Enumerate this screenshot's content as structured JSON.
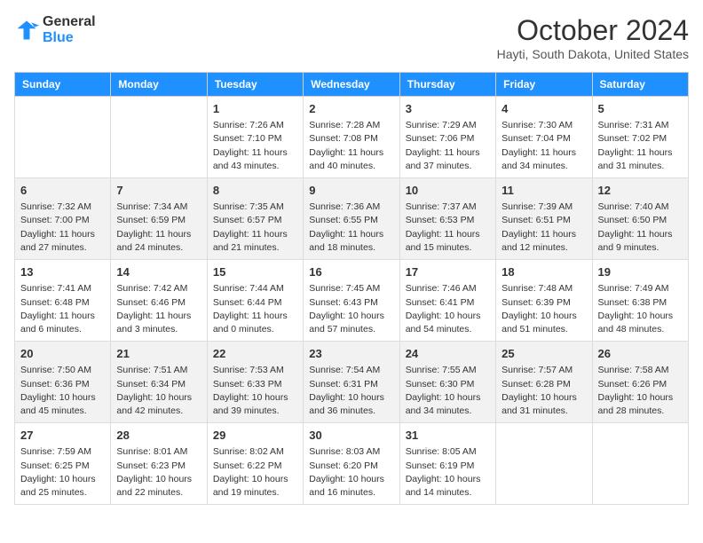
{
  "header": {
    "logo_line1": "General",
    "logo_line2": "Blue",
    "month": "October 2024",
    "location": "Hayti, South Dakota, United States"
  },
  "days_of_week": [
    "Sunday",
    "Monday",
    "Tuesday",
    "Wednesday",
    "Thursday",
    "Friday",
    "Saturday"
  ],
  "weeks": [
    [
      {
        "day": "",
        "info": ""
      },
      {
        "day": "",
        "info": ""
      },
      {
        "day": "1",
        "info": "Sunrise: 7:26 AM\nSunset: 7:10 PM\nDaylight: 11 hours and 43 minutes."
      },
      {
        "day": "2",
        "info": "Sunrise: 7:28 AM\nSunset: 7:08 PM\nDaylight: 11 hours and 40 minutes."
      },
      {
        "day": "3",
        "info": "Sunrise: 7:29 AM\nSunset: 7:06 PM\nDaylight: 11 hours and 37 minutes."
      },
      {
        "day": "4",
        "info": "Sunrise: 7:30 AM\nSunset: 7:04 PM\nDaylight: 11 hours and 34 minutes."
      },
      {
        "day": "5",
        "info": "Sunrise: 7:31 AM\nSunset: 7:02 PM\nDaylight: 11 hours and 31 minutes."
      }
    ],
    [
      {
        "day": "6",
        "info": "Sunrise: 7:32 AM\nSunset: 7:00 PM\nDaylight: 11 hours and 27 minutes."
      },
      {
        "day": "7",
        "info": "Sunrise: 7:34 AM\nSunset: 6:59 PM\nDaylight: 11 hours and 24 minutes."
      },
      {
        "day": "8",
        "info": "Sunrise: 7:35 AM\nSunset: 6:57 PM\nDaylight: 11 hours and 21 minutes."
      },
      {
        "day": "9",
        "info": "Sunrise: 7:36 AM\nSunset: 6:55 PM\nDaylight: 11 hours and 18 minutes."
      },
      {
        "day": "10",
        "info": "Sunrise: 7:37 AM\nSunset: 6:53 PM\nDaylight: 11 hours and 15 minutes."
      },
      {
        "day": "11",
        "info": "Sunrise: 7:39 AM\nSunset: 6:51 PM\nDaylight: 11 hours and 12 minutes."
      },
      {
        "day": "12",
        "info": "Sunrise: 7:40 AM\nSunset: 6:50 PM\nDaylight: 11 hours and 9 minutes."
      }
    ],
    [
      {
        "day": "13",
        "info": "Sunrise: 7:41 AM\nSunset: 6:48 PM\nDaylight: 11 hours and 6 minutes."
      },
      {
        "day": "14",
        "info": "Sunrise: 7:42 AM\nSunset: 6:46 PM\nDaylight: 11 hours and 3 minutes."
      },
      {
        "day": "15",
        "info": "Sunrise: 7:44 AM\nSunset: 6:44 PM\nDaylight: 11 hours and 0 minutes."
      },
      {
        "day": "16",
        "info": "Sunrise: 7:45 AM\nSunset: 6:43 PM\nDaylight: 10 hours and 57 minutes."
      },
      {
        "day": "17",
        "info": "Sunrise: 7:46 AM\nSunset: 6:41 PM\nDaylight: 10 hours and 54 minutes."
      },
      {
        "day": "18",
        "info": "Sunrise: 7:48 AM\nSunset: 6:39 PM\nDaylight: 10 hours and 51 minutes."
      },
      {
        "day": "19",
        "info": "Sunrise: 7:49 AM\nSunset: 6:38 PM\nDaylight: 10 hours and 48 minutes."
      }
    ],
    [
      {
        "day": "20",
        "info": "Sunrise: 7:50 AM\nSunset: 6:36 PM\nDaylight: 10 hours and 45 minutes."
      },
      {
        "day": "21",
        "info": "Sunrise: 7:51 AM\nSunset: 6:34 PM\nDaylight: 10 hours and 42 minutes."
      },
      {
        "day": "22",
        "info": "Sunrise: 7:53 AM\nSunset: 6:33 PM\nDaylight: 10 hours and 39 minutes."
      },
      {
        "day": "23",
        "info": "Sunrise: 7:54 AM\nSunset: 6:31 PM\nDaylight: 10 hours and 36 minutes."
      },
      {
        "day": "24",
        "info": "Sunrise: 7:55 AM\nSunset: 6:30 PM\nDaylight: 10 hours and 34 minutes."
      },
      {
        "day": "25",
        "info": "Sunrise: 7:57 AM\nSunset: 6:28 PM\nDaylight: 10 hours and 31 minutes."
      },
      {
        "day": "26",
        "info": "Sunrise: 7:58 AM\nSunset: 6:26 PM\nDaylight: 10 hours and 28 minutes."
      }
    ],
    [
      {
        "day": "27",
        "info": "Sunrise: 7:59 AM\nSunset: 6:25 PM\nDaylight: 10 hours and 25 minutes."
      },
      {
        "day": "28",
        "info": "Sunrise: 8:01 AM\nSunset: 6:23 PM\nDaylight: 10 hours and 22 minutes."
      },
      {
        "day": "29",
        "info": "Sunrise: 8:02 AM\nSunset: 6:22 PM\nDaylight: 10 hours and 19 minutes."
      },
      {
        "day": "30",
        "info": "Sunrise: 8:03 AM\nSunset: 6:20 PM\nDaylight: 10 hours and 16 minutes."
      },
      {
        "day": "31",
        "info": "Sunrise: 8:05 AM\nSunset: 6:19 PM\nDaylight: 10 hours and 14 minutes."
      },
      {
        "day": "",
        "info": ""
      },
      {
        "day": "",
        "info": ""
      }
    ]
  ]
}
